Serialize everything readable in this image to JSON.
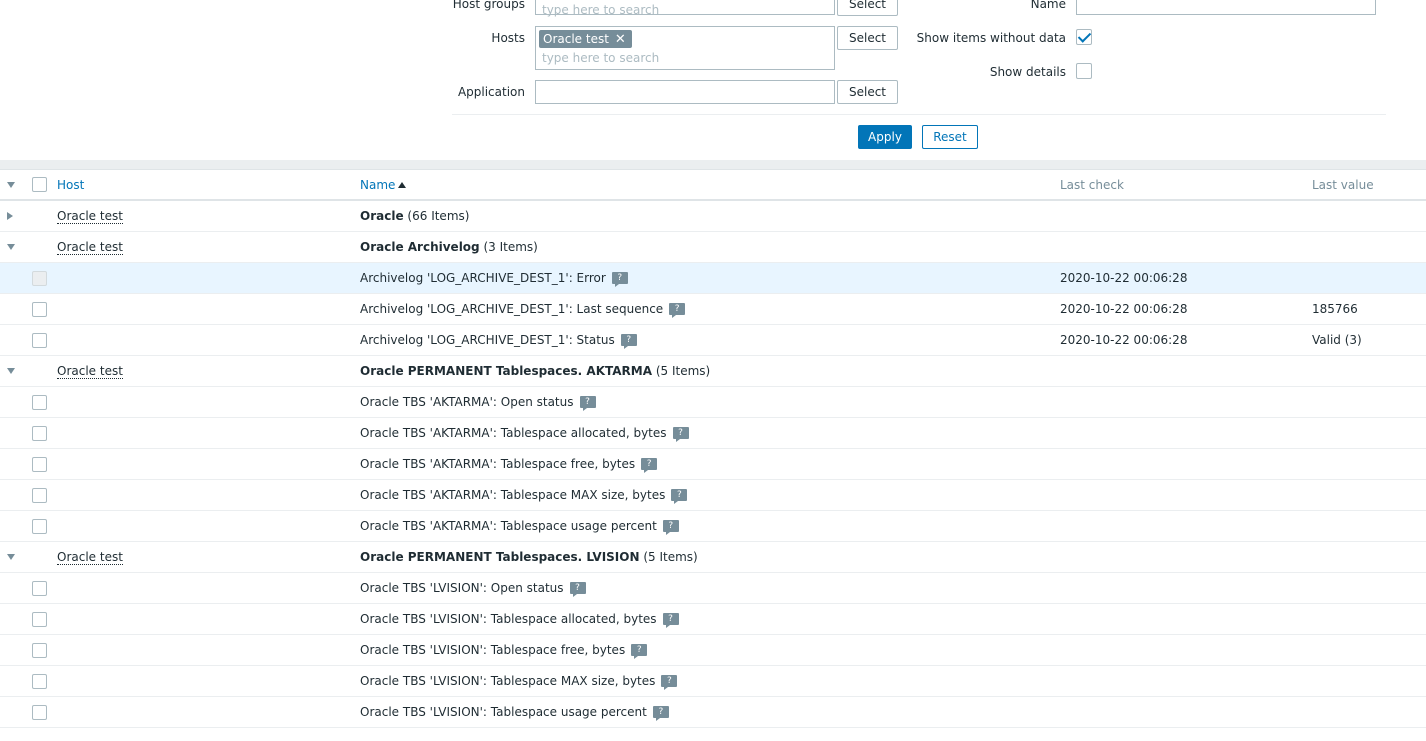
{
  "filter": {
    "host_groups_label": "Host groups",
    "host_groups_placeholder": "type here to search",
    "hosts_label": "Hosts",
    "hosts_tag": "Oracle test",
    "hosts_placeholder": "type here to search",
    "application_label": "Application",
    "select_label": "Select",
    "name_label": "Name",
    "show_without_data_label": "Show items without data",
    "show_without_data_checked": true,
    "show_details_label": "Show details",
    "show_details_checked": false,
    "apply_label": "Apply",
    "reset_label": "Reset"
  },
  "table": {
    "headers": {
      "host": "Host",
      "name": "Name",
      "last_check": "Last check",
      "last_value": "Last value"
    },
    "rows": [
      {
        "type": "group",
        "expanded": false,
        "host": "Oracle test",
        "name": "Oracle",
        "count": "(66 Items)"
      },
      {
        "type": "group",
        "expanded": true,
        "host": "Oracle test",
        "name": "Oracle Archivelog",
        "count": "(3 Items)"
      },
      {
        "type": "item",
        "highlight": true,
        "disabled": true,
        "name": "Archivelog 'LOG_ARCHIVE_DEST_1': Error",
        "last_check": "2020-10-22 00:06:28",
        "last_value": ""
      },
      {
        "type": "item",
        "name": "Archivelog 'LOG_ARCHIVE_DEST_1': Last sequence",
        "last_check": "2020-10-22 00:06:28",
        "last_value": "185766"
      },
      {
        "type": "item",
        "name": "Archivelog 'LOG_ARCHIVE_DEST_1': Status",
        "last_check": "2020-10-22 00:06:28",
        "last_value": "Valid (3)"
      },
      {
        "type": "group",
        "expanded": true,
        "host": "Oracle test",
        "name": "Oracle PERMANENT Tablespaces. AKTARMA",
        "count": "(5 Items)"
      },
      {
        "type": "item",
        "name": "Oracle TBS 'AKTARMA': Open status",
        "last_check": "",
        "last_value": ""
      },
      {
        "type": "item",
        "name": "Oracle TBS 'AKTARMA': Tablespace allocated, bytes",
        "last_check": "",
        "last_value": ""
      },
      {
        "type": "item",
        "name": "Oracle TBS 'AKTARMA': Tablespace free, bytes",
        "last_check": "",
        "last_value": ""
      },
      {
        "type": "item",
        "name": "Oracle TBS 'AKTARMA': Tablespace MAX size, bytes",
        "last_check": "",
        "last_value": ""
      },
      {
        "type": "item",
        "name": "Oracle TBS 'AKTARMA': Tablespace usage percent",
        "last_check": "",
        "last_value": ""
      },
      {
        "type": "group",
        "expanded": true,
        "host": "Oracle test",
        "name": "Oracle PERMANENT Tablespaces. LVISION",
        "count": "(5 Items)"
      },
      {
        "type": "item",
        "name": "Oracle TBS 'LVISION': Open status",
        "last_check": "",
        "last_value": ""
      },
      {
        "type": "item",
        "name": "Oracle TBS 'LVISION': Tablespace allocated, bytes",
        "last_check": "",
        "last_value": ""
      },
      {
        "type": "item",
        "name": "Oracle TBS 'LVISION': Tablespace free, bytes",
        "last_check": "",
        "last_value": ""
      },
      {
        "type": "item",
        "name": "Oracle TBS 'LVISION': Tablespace MAX size, bytes",
        "last_check": "",
        "last_value": ""
      },
      {
        "type": "item",
        "name": "Oracle TBS 'LVISION': Tablespace usage percent",
        "last_check": "",
        "last_value": ""
      }
    ],
    "hint_symbol": "?"
  },
  "colors": {
    "accent": "#0275b8",
    "tag_bg": "#768d99",
    "row_highlight": "#e8f5ff"
  }
}
